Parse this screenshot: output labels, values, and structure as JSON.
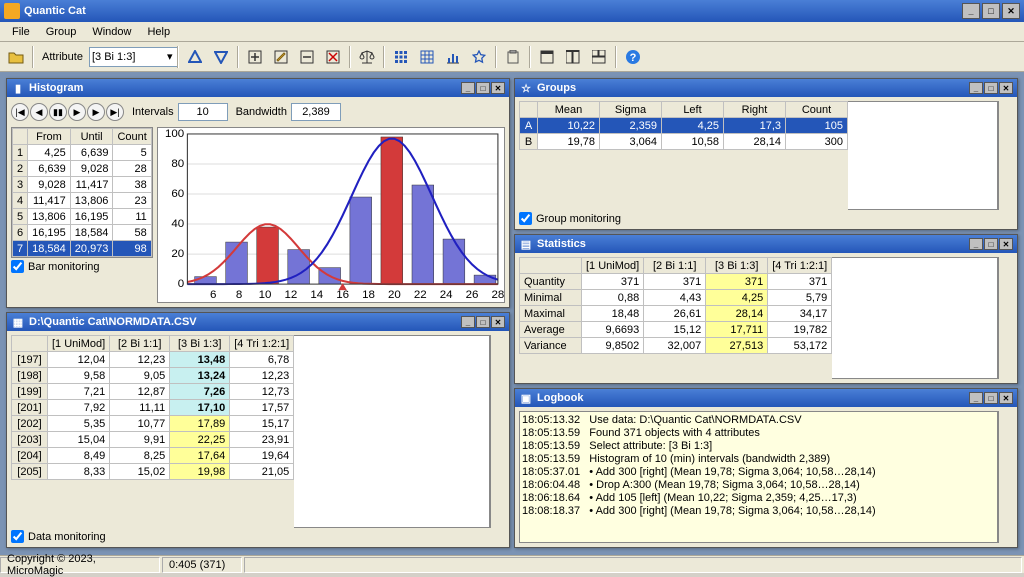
{
  "app": {
    "title": "Quantic Cat"
  },
  "menu": {
    "file": "File",
    "group": "Group",
    "window": "Window",
    "help": "Help"
  },
  "toolbar": {
    "attribute_label": "Attribute",
    "attribute_value": "[3 Bi 1:3]"
  },
  "histogram": {
    "title": "Histogram",
    "intervals_label": "Intervals",
    "intervals_value": "10",
    "bandwidth_label": "Bandwidth",
    "bandwidth_value": "2,389",
    "table_headers": [
      "From",
      "Until",
      "Count"
    ],
    "rows": [
      {
        "i": "1",
        "from": "4,25",
        "until": "6,639",
        "count": "5"
      },
      {
        "i": "2",
        "from": "6,639",
        "until": "9,028",
        "count": "28"
      },
      {
        "i": "3",
        "from": "9,028",
        "until": "11,417",
        "count": "38"
      },
      {
        "i": "4",
        "from": "11,417",
        "until": "13,806",
        "count": "23"
      },
      {
        "i": "5",
        "from": "13,806",
        "until": "16,195",
        "count": "11"
      },
      {
        "i": "6",
        "from": "16,195",
        "until": "18,584",
        "count": "58"
      },
      {
        "i": "7",
        "from": "18,584",
        "until": "20,973",
        "count": "98"
      }
    ],
    "bar_monitoring": "Bar monitoring"
  },
  "chart_data": {
    "type": "bar",
    "categories": [
      6,
      8,
      10,
      12,
      14,
      16,
      18,
      20,
      22,
      24,
      26,
      28
    ],
    "x_ticks": [
      6,
      8,
      10,
      12,
      14,
      16,
      18,
      20,
      22,
      24,
      26,
      28
    ],
    "y_ticks": [
      0,
      20,
      40,
      60,
      80,
      100
    ],
    "bars": [
      {
        "x": 5.4,
        "h": 5,
        "c": "#7474d6"
      },
      {
        "x": 7.8,
        "h": 28,
        "c": "#7474d6"
      },
      {
        "x": 10.2,
        "h": 38,
        "c": "#d33a3a"
      },
      {
        "x": 12.6,
        "h": 23,
        "c": "#7474d6"
      },
      {
        "x": 15.0,
        "h": 11,
        "c": "#7474d6"
      },
      {
        "x": 17.4,
        "h": 58,
        "c": "#7474d6"
      },
      {
        "x": 19.8,
        "h": 98,
        "c": "#d33a3a"
      },
      {
        "x": 22.2,
        "h": 66,
        "c": "#7474d6"
      },
      {
        "x": 24.6,
        "h": 30,
        "c": "#7474d6"
      },
      {
        "x": 27.0,
        "h": 6,
        "c": "#7474d6"
      }
    ],
    "curves": [
      {
        "name": "A",
        "color": "#d33a3a",
        "mu": 10.2,
        "sigma": 2.4,
        "peak": 40
      },
      {
        "name": "B",
        "color": "#2020c0",
        "mu": 19.8,
        "sigma": 3.1,
        "peak": 97
      }
    ],
    "xlim": [
      4,
      28
    ],
    "ylim": [
      0,
      100
    ]
  },
  "datafile": {
    "title": "D:\\Quantic Cat\\NORMDATA.CSV",
    "headers": [
      "[1 UniMod]",
      "[2 Bi 1:1]",
      "[3 Bi 1:3]",
      "[4 Tri 1:2:1]"
    ],
    "rows": [
      {
        "i": "[197]",
        "c": [
          "12,04",
          "12,23",
          "13,48",
          "6,78"
        ],
        "hl": "c",
        "b": true
      },
      {
        "i": "[198]",
        "c": [
          "9,58",
          "9,05",
          "13,24",
          "12,23"
        ],
        "hl": "c",
        "b": true
      },
      {
        "i": "[199]",
        "c": [
          "7,21",
          "12,87",
          "7,26",
          "12,73"
        ],
        "hl": "c",
        "b": true
      },
      {
        "i": "[201]",
        "c": [
          "7,92",
          "11,11",
          "17,10",
          "17,57"
        ],
        "hl": "c",
        "b": true
      },
      {
        "i": "[202]",
        "c": [
          "5,35",
          "10,77",
          "17,89",
          "15,17"
        ],
        "hl": "y"
      },
      {
        "i": "[203]",
        "c": [
          "15,04",
          "9,91",
          "22,25",
          "23,91"
        ],
        "hl": "y"
      },
      {
        "i": "[204]",
        "c": [
          "8,49",
          "8,25",
          "17,64",
          "19,64"
        ],
        "hl": "y"
      },
      {
        "i": "[205]",
        "c": [
          "8,33",
          "15,02",
          "19,98",
          "21,05"
        ],
        "hl": "y"
      }
    ],
    "data_monitoring": "Data monitoring"
  },
  "groups": {
    "title": "Groups",
    "headers": [
      "Mean",
      "Sigma",
      "Left",
      "Right",
      "Count"
    ],
    "rows": [
      {
        "i": "A",
        "c": [
          "10,22",
          "2,359",
          "4,25",
          "17,3",
          "105"
        ],
        "sel": true
      },
      {
        "i": "B",
        "c": [
          "19,78",
          "3,064",
          "10,58",
          "28,14",
          "300"
        ]
      }
    ],
    "group_monitoring": "Group monitoring"
  },
  "stats": {
    "title": "Statistics",
    "headers": [
      "[1 UniMod]",
      "[2 Bi 1:1]",
      "[3 Bi 1:3]",
      "[4 Tri 1:2:1]"
    ],
    "rows": [
      {
        "i": "Quantity",
        "c": [
          "371",
          "371",
          "371",
          "371"
        ]
      },
      {
        "i": "Minimal",
        "c": [
          "0,88",
          "4,43",
          "4,25",
          "5,79"
        ]
      },
      {
        "i": "Maximal",
        "c": [
          "18,48",
          "26,61",
          "28,14",
          "34,17"
        ]
      },
      {
        "i": "Average",
        "c": [
          "9,6693",
          "15,12",
          "17,711",
          "19,782"
        ]
      },
      {
        "i": "Variance",
        "c": [
          "9,8502",
          "32,007",
          "27,513",
          "53,172"
        ]
      }
    ],
    "hlcol": 2
  },
  "logbook": {
    "title": "Logbook",
    "lines": [
      "18:05:13.32   Use data: D:\\Quantic Cat\\NORMDATA.CSV",
      "18:05:13.59   Found 371 objects with 4 attributes",
      "18:05:13.59   Select attribute: [3 Bi 1:3]",
      "18:05:13.59   Histogram of 10 (min) intervals (bandwidth 2,389)",
      "18:05:37.01   • Add 300 [right] (Mean 19,78; Sigma 3,064; 10,58…28,14)",
      "18:06:04.48   • Drop A:300 (Mean 19,78; Sigma 3,064; 10,58…28,14)",
      "18:06:18.64   • Add 105 [left] (Mean 10,22; Sigma 2,359; 4,25…17,3)",
      "18:08:18.37   • Add 300 [right] (Mean 19,78; Sigma 3,064; 10,58…28,14)"
    ]
  },
  "status": {
    "copyright": "Copyright © 2023, MicroMagic",
    "pos": "0:405 (371)"
  }
}
